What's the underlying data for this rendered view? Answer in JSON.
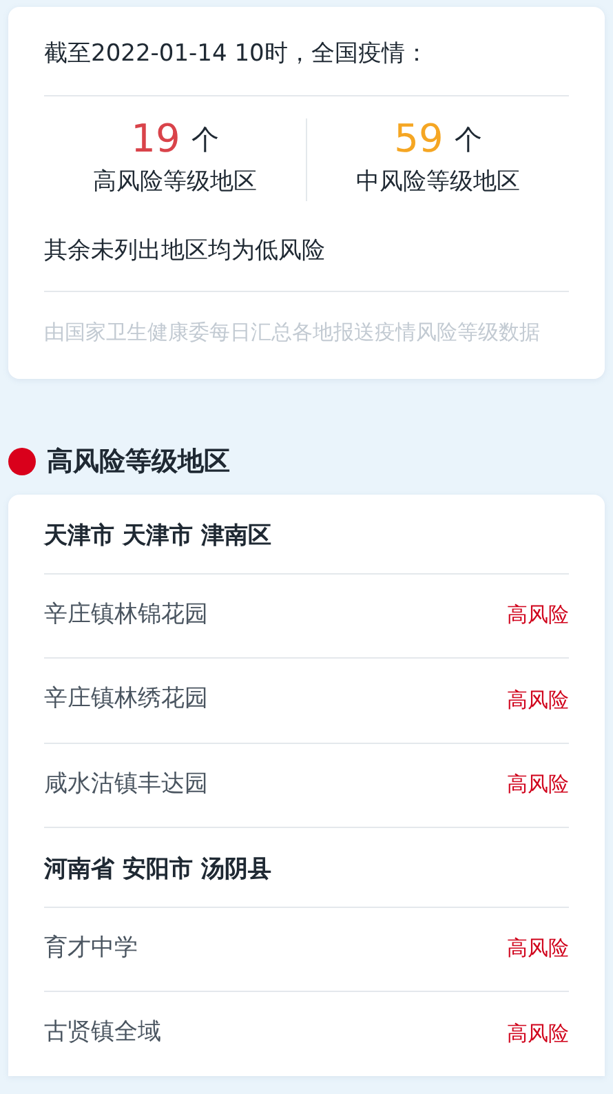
{
  "summary": {
    "title": "截至2022-01-14 10时，全国疫情：",
    "stats": [
      {
        "count": "19",
        "unit": "个",
        "label": "高风险等级地区",
        "color": "#d9434a"
      },
      {
        "count": "59",
        "unit": "个",
        "label": "中风险等级地区",
        "color": "#f5a623"
      }
    ],
    "note": "其余未列出地区均为低风险",
    "source": "由国家卫生健康委每日汇总各地报送疫情风险等级数据"
  },
  "section": {
    "title": "高风险等级地区",
    "color": "#d9001b",
    "groups": [
      {
        "region": "天津市 天津市 津南区",
        "places": [
          {
            "name": "辛庄镇林锦花园",
            "risk": "高风险"
          },
          {
            "name": "辛庄镇林绣花园",
            "risk": "高风险"
          },
          {
            "name": "咸水沽镇丰达园",
            "risk": "高风险"
          }
        ]
      },
      {
        "region": "河南省 安阳市 汤阴县",
        "places": [
          {
            "name": "育才中学",
            "risk": "高风险"
          },
          {
            "name": "古贤镇全域",
            "risk": "高风险"
          }
        ]
      }
    ]
  }
}
